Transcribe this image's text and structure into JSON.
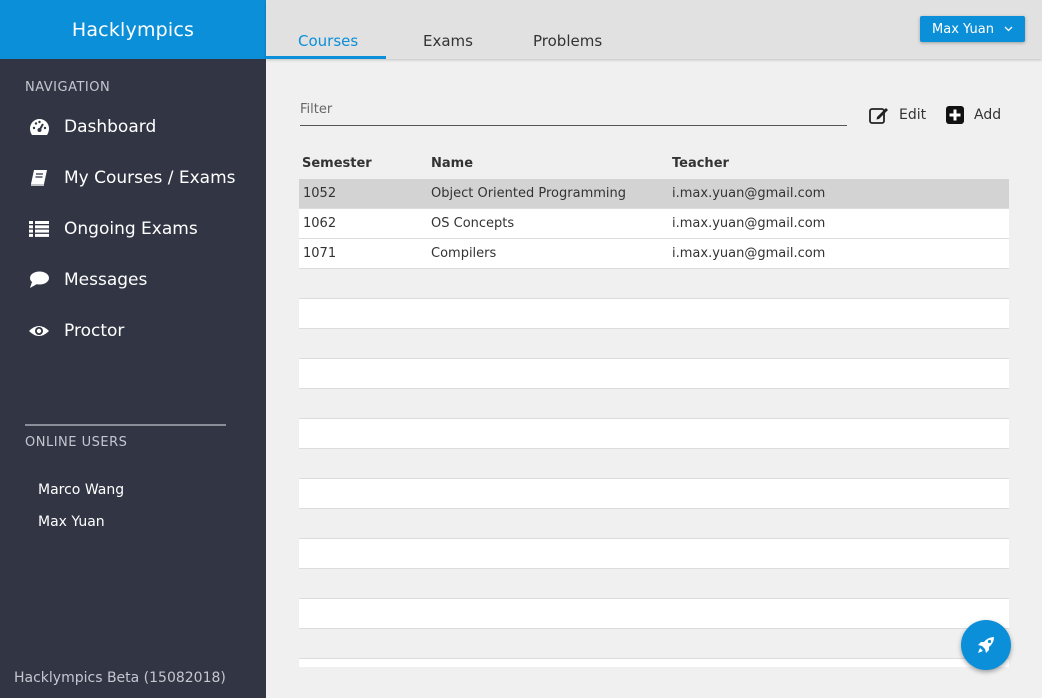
{
  "app": {
    "title": "Hacklympics"
  },
  "sidebar": {
    "nav_title": "NAVIGATION",
    "items": [
      {
        "label": "Dashboard",
        "icon": "dashboard-icon"
      },
      {
        "label": "My Courses / Exams",
        "icon": "book-icon"
      },
      {
        "label": "Ongoing Exams",
        "icon": "list-icon"
      },
      {
        "label": "Messages",
        "icon": "chat-bubble-icon"
      },
      {
        "label": "Proctor",
        "icon": "eye-icon"
      }
    ],
    "online_title": "ONLINE USERS",
    "online_users": [
      "Marco Wang",
      "Max Yuan"
    ],
    "footer": "Hacklympics Beta (15082018)"
  },
  "header": {
    "tabs": [
      "Courses",
      "Exams",
      "Problems"
    ],
    "active_tab": "Courses",
    "user": "Max Yuan"
  },
  "toolbar": {
    "filter_placeholder": "Filter",
    "edit_label": "Edit",
    "add_label": "Add"
  },
  "table": {
    "columns": [
      "Semester",
      "Name",
      "Teacher"
    ],
    "rows": [
      [
        "1052",
        "Object Oriented Programming",
        "i.max.yuan@gmail.com"
      ],
      [
        "1062",
        "OS Concepts",
        "i.max.yuan@gmail.com"
      ],
      [
        "1071",
        "Compilers",
        "i.max.yuan@gmail.com"
      ]
    ],
    "selected_row": 0
  },
  "colors": {
    "accent": "#0b8fd8",
    "sidebar_bg": "#323644",
    "selected_row": "#d3d3d3"
  }
}
